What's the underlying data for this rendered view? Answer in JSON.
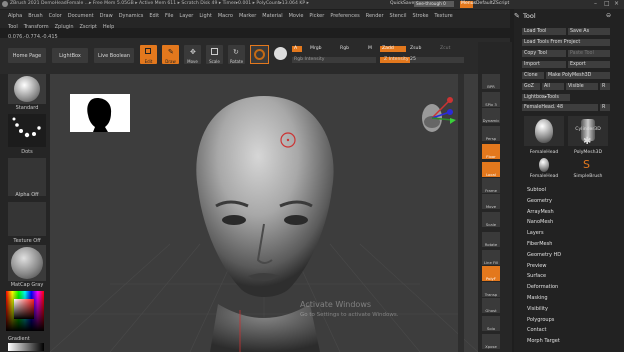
{
  "titlebar": {
    "info": "ZBrush 2021   DemoHeadFemale   ...▸ Free Mem 5.05GB ▸ Active Mem 611 ▸ Scratch Disk 49 ▸ Timer▸0.001 ▸ PolyCount▸13.064 KP ▸ ",
    "quicksave": "QuickSave",
    "see_through": "See-through 0",
    "menus": "Menus",
    "default_script": "DefaultZScript"
  },
  "menubar": {
    "row1": [
      "Alpha",
      "Brush",
      "Color",
      "Document",
      "Draw",
      "Dynamics",
      "Edit",
      "File",
      "Layer",
      "Light",
      "Macro",
      "Marker",
      "Material",
      "Movie",
      "Picker",
      "Preferences",
      "Render",
      "Stencil",
      "Stroke",
      "Texture"
    ],
    "row2": [
      "Tool",
      "Transform",
      "Zplugin",
      "Zscript",
      "Help"
    ],
    "coords": "0.076,-0.774,-0.415"
  },
  "shelf": {
    "home_page": "Home Page",
    "lightbox": "LightBox",
    "live_boolean": "Live Boolean",
    "edit": "Edit",
    "draw": "Draw",
    "move": "Move",
    "scale": "Scale",
    "rotate": "Rotate",
    "a_btn": "A",
    "mrgb": "Mrgb",
    "rgb": "Rgb",
    "m": "M",
    "zadd": "Zadd",
    "zsub": "Zsub",
    "zcut": "Zcut",
    "rgb_intensity": "Rgb Intensity",
    "z_intensity": "Z Intensity 25",
    "focal": "Focal",
    "draw_size": "Draw"
  },
  "left": {
    "standard": "Standard",
    "dots": "Dots",
    "alpha_off": "Alpha Off",
    "texture_off": "Texture Off",
    "matcap": "MatCap Gray",
    "gradient": "Gradient"
  },
  "righttools": [
    "BPR",
    "SPix 3",
    "Dynamic",
    "Persp",
    "Floor",
    "Local",
    "Frame",
    "Move",
    "Scale",
    "Rotate",
    "Line Fill",
    "PolyF",
    "Transp",
    "Ghost",
    "Solo",
    "Xpose"
  ],
  "tool": {
    "header": "Tool",
    "load_tool": "Load Tool",
    "save_as": "Save As",
    "load_from_project": "Load Tools From Project",
    "copy_tool": "Copy Tool",
    "paste_tool": "Paste Tool",
    "import": "Import",
    "export": "Export",
    "clone": "Clone",
    "make_polymesh": "Make PolyMesh3D",
    "goz": "GoZ",
    "all": "All",
    "visible": "Visible",
    "r": "R",
    "lightbox_tools": "Lightbox▸Tools",
    "femalehead_slider": "FemaleHead. 48",
    "thumbs": [
      "FemaleHead",
      "Cylinder3D",
      "FemaleHead",
      "PolyMesh3D",
      "FemaleHead",
      "SimpleBrush"
    ],
    "subpalettes": [
      "Subtool",
      "Geometry",
      "ArrayMesh",
      "NanoMesh",
      "Layers",
      "FiberMesh",
      "Geometry HD",
      "Preview",
      "Surface",
      "Deformation",
      "Masking",
      "Visibility",
      "Polygroups",
      "Contact",
      "Morph Target"
    ]
  },
  "watermark": {
    "line1": "Activate Windows",
    "line2": "Go to Settings to activate Windows."
  },
  "colors": {
    "accent_orange": "#e3781d",
    "panel_bg": "#222222",
    "canvas_bg": "#3d3d3d"
  }
}
